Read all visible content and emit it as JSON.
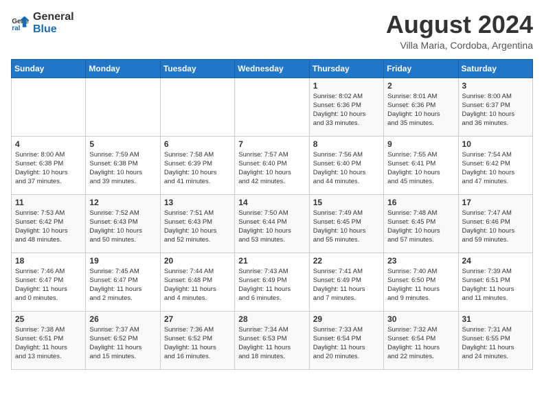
{
  "logo": {
    "general": "General",
    "blue": "Blue"
  },
  "header": {
    "title": "August 2024",
    "subtitle": "Villa Maria, Cordoba, Argentina"
  },
  "weekdays": [
    "Sunday",
    "Monday",
    "Tuesday",
    "Wednesday",
    "Thursday",
    "Friday",
    "Saturday"
  ],
  "weeks": [
    [
      {
        "day": "",
        "info": ""
      },
      {
        "day": "",
        "info": ""
      },
      {
        "day": "",
        "info": ""
      },
      {
        "day": "",
        "info": ""
      },
      {
        "day": "1",
        "info": "Sunrise: 8:02 AM\nSunset: 6:36 PM\nDaylight: 10 hours\nand 33 minutes."
      },
      {
        "day": "2",
        "info": "Sunrise: 8:01 AM\nSunset: 6:36 PM\nDaylight: 10 hours\nand 35 minutes."
      },
      {
        "day": "3",
        "info": "Sunrise: 8:00 AM\nSunset: 6:37 PM\nDaylight: 10 hours\nand 36 minutes."
      }
    ],
    [
      {
        "day": "4",
        "info": "Sunrise: 8:00 AM\nSunset: 6:38 PM\nDaylight: 10 hours\nand 37 minutes."
      },
      {
        "day": "5",
        "info": "Sunrise: 7:59 AM\nSunset: 6:38 PM\nDaylight: 10 hours\nand 39 minutes."
      },
      {
        "day": "6",
        "info": "Sunrise: 7:58 AM\nSunset: 6:39 PM\nDaylight: 10 hours\nand 41 minutes."
      },
      {
        "day": "7",
        "info": "Sunrise: 7:57 AM\nSunset: 6:40 PM\nDaylight: 10 hours\nand 42 minutes."
      },
      {
        "day": "8",
        "info": "Sunrise: 7:56 AM\nSunset: 6:40 PM\nDaylight: 10 hours\nand 44 minutes."
      },
      {
        "day": "9",
        "info": "Sunrise: 7:55 AM\nSunset: 6:41 PM\nDaylight: 10 hours\nand 45 minutes."
      },
      {
        "day": "10",
        "info": "Sunrise: 7:54 AM\nSunset: 6:42 PM\nDaylight: 10 hours\nand 47 minutes."
      }
    ],
    [
      {
        "day": "11",
        "info": "Sunrise: 7:53 AM\nSunset: 6:42 PM\nDaylight: 10 hours\nand 48 minutes."
      },
      {
        "day": "12",
        "info": "Sunrise: 7:52 AM\nSunset: 6:43 PM\nDaylight: 10 hours\nand 50 minutes."
      },
      {
        "day": "13",
        "info": "Sunrise: 7:51 AM\nSunset: 6:43 PM\nDaylight: 10 hours\nand 52 minutes."
      },
      {
        "day": "14",
        "info": "Sunrise: 7:50 AM\nSunset: 6:44 PM\nDaylight: 10 hours\nand 53 minutes."
      },
      {
        "day": "15",
        "info": "Sunrise: 7:49 AM\nSunset: 6:45 PM\nDaylight: 10 hours\nand 55 minutes."
      },
      {
        "day": "16",
        "info": "Sunrise: 7:48 AM\nSunset: 6:45 PM\nDaylight: 10 hours\nand 57 minutes."
      },
      {
        "day": "17",
        "info": "Sunrise: 7:47 AM\nSunset: 6:46 PM\nDaylight: 10 hours\nand 59 minutes."
      }
    ],
    [
      {
        "day": "18",
        "info": "Sunrise: 7:46 AM\nSunset: 6:47 PM\nDaylight: 11 hours\nand 0 minutes."
      },
      {
        "day": "19",
        "info": "Sunrise: 7:45 AM\nSunset: 6:47 PM\nDaylight: 11 hours\nand 2 minutes."
      },
      {
        "day": "20",
        "info": "Sunrise: 7:44 AM\nSunset: 6:48 PM\nDaylight: 11 hours\nand 4 minutes."
      },
      {
        "day": "21",
        "info": "Sunrise: 7:43 AM\nSunset: 6:49 PM\nDaylight: 11 hours\nand 6 minutes."
      },
      {
        "day": "22",
        "info": "Sunrise: 7:41 AM\nSunset: 6:49 PM\nDaylight: 11 hours\nand 7 minutes."
      },
      {
        "day": "23",
        "info": "Sunrise: 7:40 AM\nSunset: 6:50 PM\nDaylight: 11 hours\nand 9 minutes."
      },
      {
        "day": "24",
        "info": "Sunrise: 7:39 AM\nSunset: 6:51 PM\nDaylight: 11 hours\nand 11 minutes."
      }
    ],
    [
      {
        "day": "25",
        "info": "Sunrise: 7:38 AM\nSunset: 6:51 PM\nDaylight: 11 hours\nand 13 minutes."
      },
      {
        "day": "26",
        "info": "Sunrise: 7:37 AM\nSunset: 6:52 PM\nDaylight: 11 hours\nand 15 minutes."
      },
      {
        "day": "27",
        "info": "Sunrise: 7:36 AM\nSunset: 6:52 PM\nDaylight: 11 hours\nand 16 minutes."
      },
      {
        "day": "28",
        "info": "Sunrise: 7:34 AM\nSunset: 6:53 PM\nDaylight: 11 hours\nand 18 minutes."
      },
      {
        "day": "29",
        "info": "Sunrise: 7:33 AM\nSunset: 6:54 PM\nDaylight: 11 hours\nand 20 minutes."
      },
      {
        "day": "30",
        "info": "Sunrise: 7:32 AM\nSunset: 6:54 PM\nDaylight: 11 hours\nand 22 minutes."
      },
      {
        "day": "31",
        "info": "Sunrise: 7:31 AM\nSunset: 6:55 PM\nDaylight: 11 hours\nand 24 minutes."
      }
    ]
  ]
}
